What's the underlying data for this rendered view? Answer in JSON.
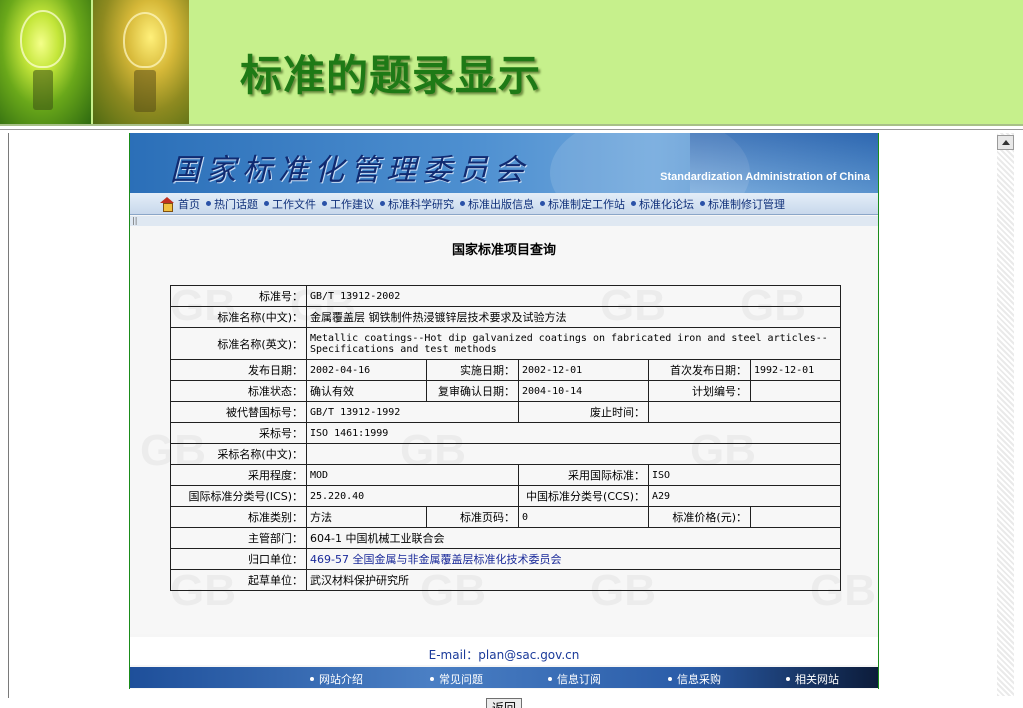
{
  "slide": {
    "title": "标准的题录显示"
  },
  "site": {
    "title": "国家标准化管理委员会",
    "subtitle": "Standardization Administration of China",
    "nav": [
      "首页",
      "热门话题",
      "工作文件",
      "工作建议",
      "标准科学研究",
      "标准出版信息",
      "标准制定工作站",
      "标准化论坛",
      "标准制修订管理"
    ],
    "strip_mark": "||"
  },
  "page": {
    "heading": "国家标准项目查询",
    "watermark": "GB",
    "fields": {
      "std_no": {
        "label": "标准号：",
        "value": "GB/T 13912-2002"
      },
      "name_cn": {
        "label": "标准名称(中文)：",
        "value": "金属覆盖层 钢铁制件热浸镀锌层技术要求及试验方法"
      },
      "name_en": {
        "label": "标准名称(英文)：",
        "value": "Metallic coatings--Hot dip galvanized coatings on fabricated iron and steel articles--Specifications and test methods"
      },
      "publish_date": {
        "label": "发布日期：",
        "value": "2002-04-16"
      },
      "impl_date": {
        "label": "实施日期：",
        "value": "2002-12-01"
      },
      "first_publish_date": {
        "label": "首次发布日期：",
        "value": "1992-12-01"
      },
      "status": {
        "label": "标准状态：",
        "value": "确认有效"
      },
      "review_date": {
        "label": "复审确认日期：",
        "value": "2004-10-14"
      },
      "plan_no": {
        "label": "计划编号：",
        "value": ""
      },
      "replaced": {
        "label": "被代替国标号：",
        "value": "GB/T 13912-1992"
      },
      "abolish_time": {
        "label": "废止时间：",
        "value": ""
      },
      "adopted_no": {
        "label": "采标号：",
        "value": "ISO 1461:1999"
      },
      "adopted_name_cn": {
        "label": "采标名称(中文)：",
        "value": ""
      },
      "adoption_degree": {
        "label": "采用程度：",
        "value": "MOD"
      },
      "adopted_intl": {
        "label": "采用国际标准：",
        "value": "ISO"
      },
      "ics": {
        "label": "国际标准分类号(ICS)：",
        "value": "25.220.40"
      },
      "ccs": {
        "label": "中国标准分类号(CCS)：",
        "value": "A29"
      },
      "category": {
        "label": "标准类别：",
        "value": "方法"
      },
      "pages": {
        "label": "标准页码：",
        "value": "0"
      },
      "price": {
        "label": "标准价格(元)：",
        "value": ""
      },
      "dept": {
        "label": "主管部门：",
        "value": "604-1 中国机械工业联合会"
      },
      "owner": {
        "label": "归口单位：",
        "value": "469-57 全国金属与非金属覆盖层标准化技术委员会"
      },
      "drafter": {
        "label": "起草单位：",
        "value": "武汉材料保护研究所"
      }
    },
    "back_button": "返回"
  },
  "footer": {
    "email": "E-mail：plan@sac.gov.cn",
    "nav": [
      "网站介绍",
      "常见问题",
      "信息订阅",
      "信息采购",
      "相关网站"
    ]
  }
}
